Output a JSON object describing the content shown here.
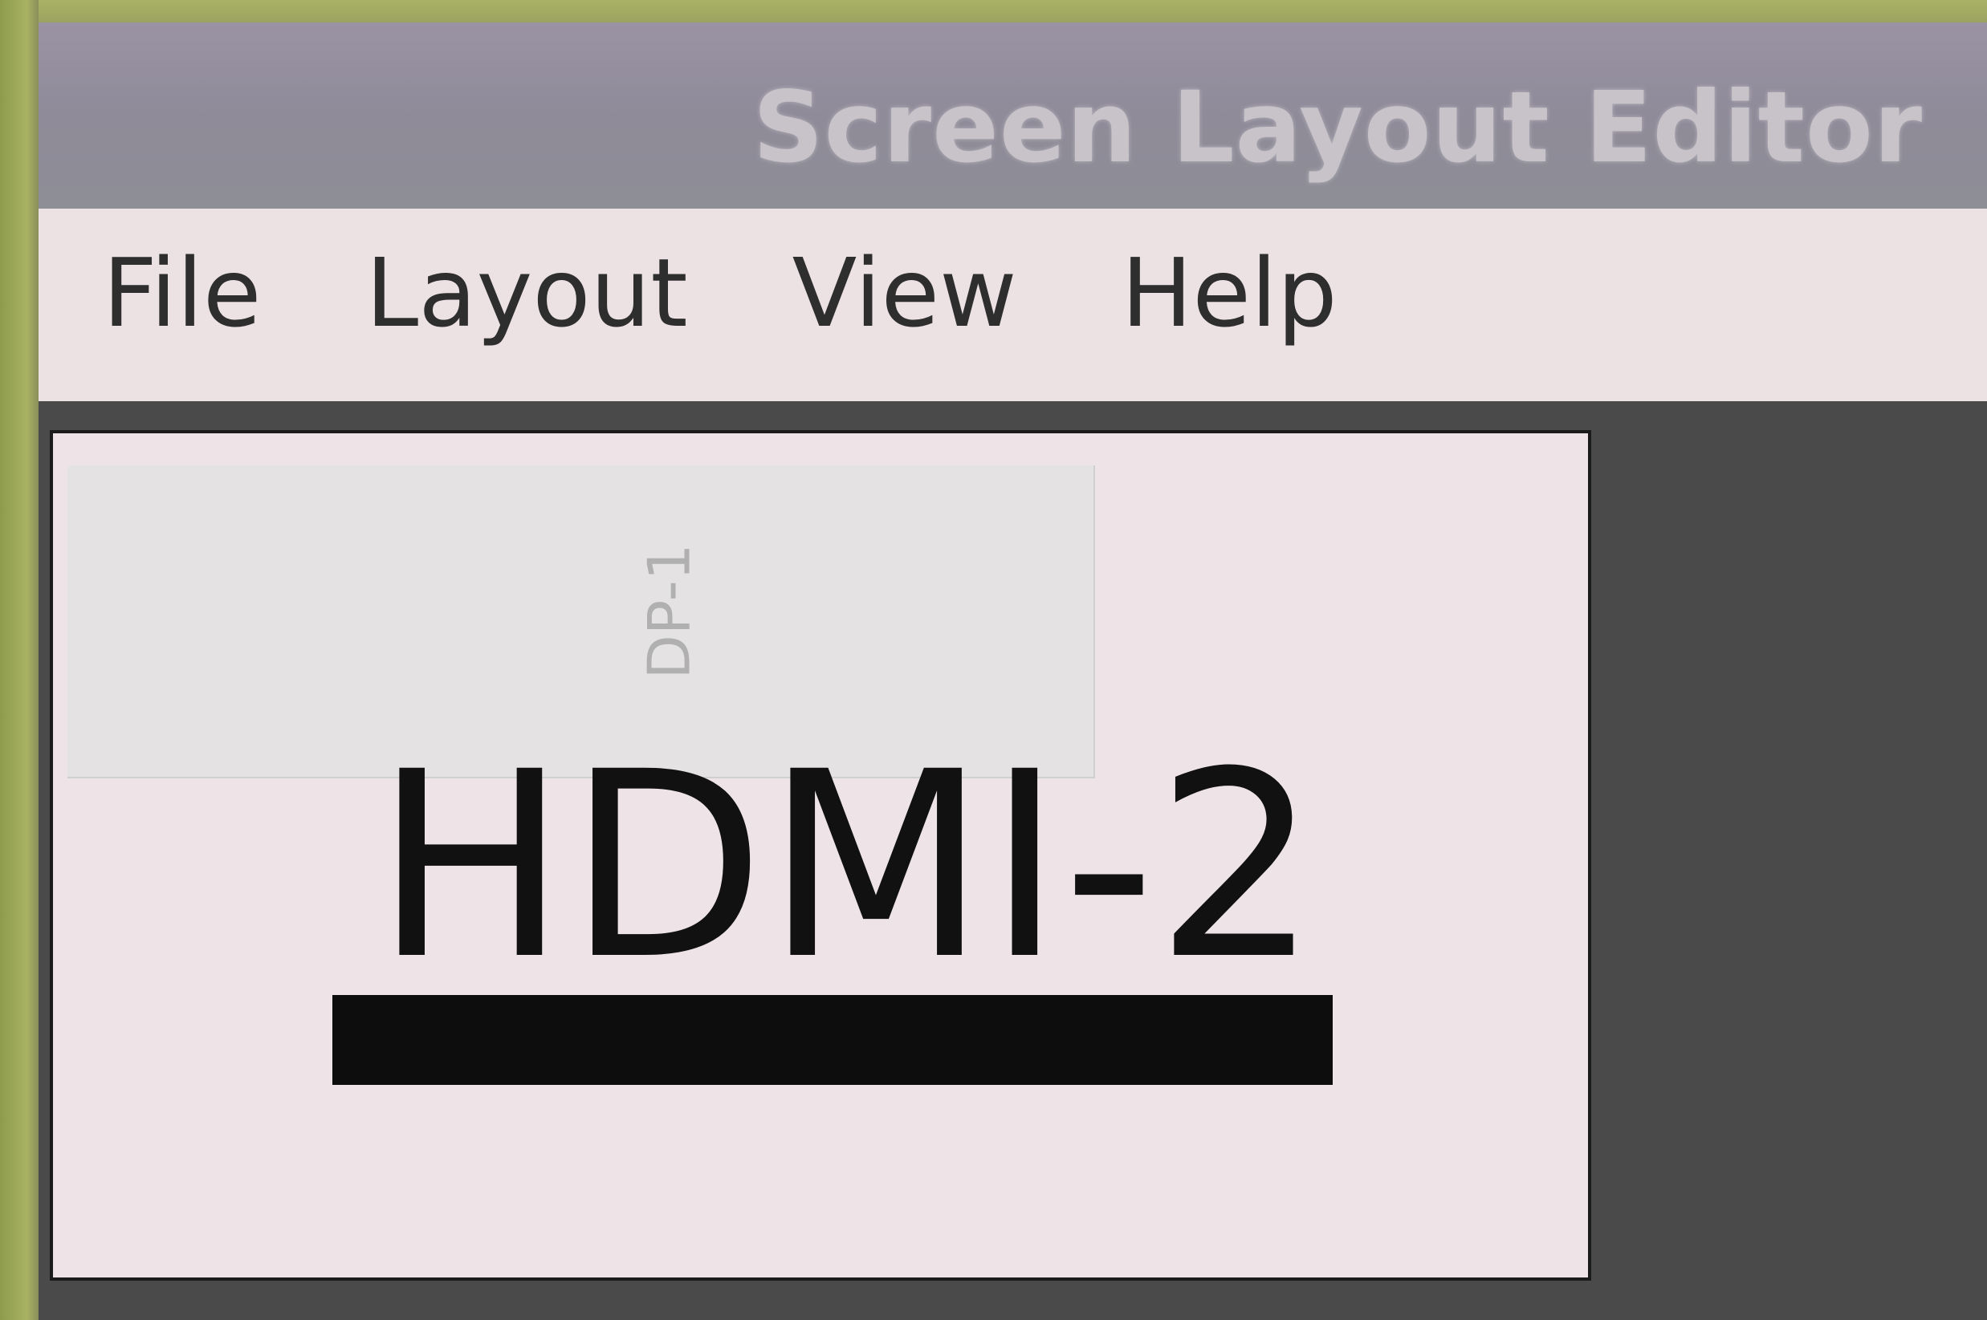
{
  "window": {
    "title": "Screen Layout Editor"
  },
  "menubar": {
    "items": [
      {
        "label": "File"
      },
      {
        "label": "Layout"
      },
      {
        "label": "View"
      },
      {
        "label": "Help"
      }
    ]
  },
  "screens": {
    "secondary": {
      "label": "DP-1"
    },
    "primary": {
      "label": "HDMI-2"
    }
  },
  "colors": {
    "titlebar": "#908b99",
    "menubar": "#ece2e4",
    "canvas": "#4a4a4a",
    "screen": "#eee4e8"
  }
}
